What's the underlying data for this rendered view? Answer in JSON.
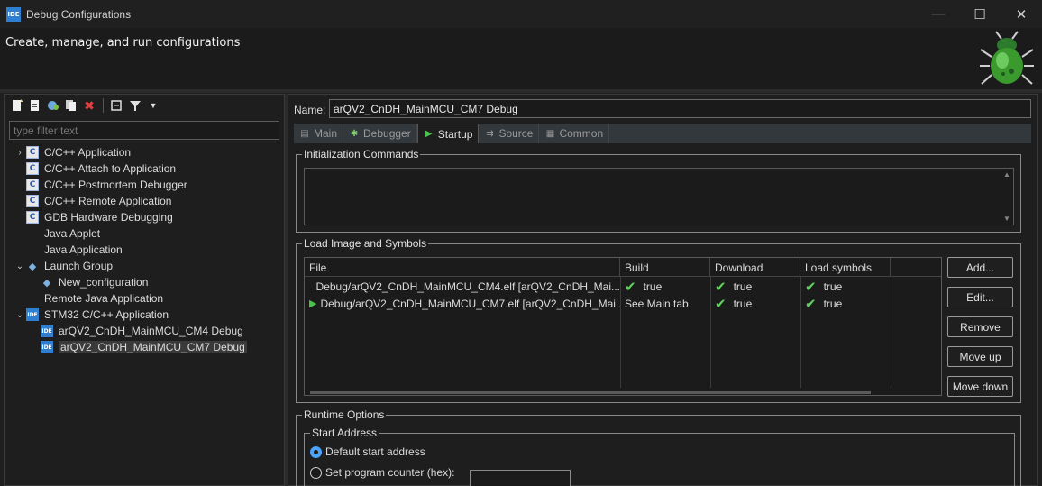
{
  "window": {
    "title": "Debug Configurations",
    "app_icon": "IDE"
  },
  "banner": {
    "text": "Create, manage, and run configurations"
  },
  "filter": {
    "placeholder": "type filter text"
  },
  "tree": [
    {
      "label": "C/C++ Application",
      "icon": "C",
      "indent": 0,
      "twisty": "›"
    },
    {
      "label": "C/C++ Attach to Application",
      "icon": "C",
      "indent": 0,
      "twisty": ""
    },
    {
      "label": "C/C++ Postmortem Debugger",
      "icon": "C",
      "indent": 0,
      "twisty": ""
    },
    {
      "label": "C/C++ Remote Application",
      "icon": "C",
      "indent": 0,
      "twisty": ""
    },
    {
      "label": "GDB Hardware Debugging",
      "icon": "C",
      "indent": 0,
      "twisty": ""
    },
    {
      "label": "Java Applet",
      "icon": "",
      "indent": 0,
      "twisty": ""
    },
    {
      "label": "Java Application",
      "icon": "",
      "indent": 0,
      "twisty": ""
    },
    {
      "label": "Launch Group",
      "icon": "grp",
      "indent": 0,
      "twisty": "⌄"
    },
    {
      "label": "New_configuration",
      "icon": "grp",
      "indent": 1,
      "twisty": ""
    },
    {
      "label": "Remote Java Application",
      "icon": "",
      "indent": 0,
      "twisty": ""
    },
    {
      "label": "STM32 C/C++ Application",
      "icon": "IDE",
      "indent": 0,
      "twisty": "⌄"
    },
    {
      "label": "arQV2_CnDH_MainMCU_CM4 Debug",
      "icon": "IDE",
      "indent": 1,
      "twisty": ""
    },
    {
      "label": "arQV2_CnDH_MainMCU_CM7 Debug",
      "icon": "IDE",
      "indent": 1,
      "twisty": "",
      "selected": true
    }
  ],
  "config": {
    "name_label": "Name:",
    "name_value": "arQV2_CnDH_MainMCU_CM7 Debug"
  },
  "tabs": [
    {
      "label": "Main",
      "icon": "▤"
    },
    {
      "label": "Debugger",
      "icon": "✱"
    },
    {
      "label": "Startup",
      "icon": "▶",
      "active": true
    },
    {
      "label": "Source",
      "icon": "⇉"
    },
    {
      "label": "Common",
      "icon": "▦"
    }
  ],
  "init": {
    "title": "Initialization Commands"
  },
  "load": {
    "title": "Load Image and Symbols",
    "columns": [
      "File",
      "Build",
      "Download",
      "Load symbols"
    ],
    "rows": [
      {
        "file": "Debug/arQV2_CnDH_MainMCU_CM4.elf [arQV2_CnDH_Mai...",
        "build": "true",
        "build_check": true,
        "download": "true",
        "symbols": "true",
        "play": false
      },
      {
        "file": "Debug/arQV2_CnDH_MainMCU_CM7.elf [arQV2_CnDH_Mai...",
        "build": "See Main tab",
        "build_check": false,
        "download": "true",
        "symbols": "true",
        "play": true
      }
    ],
    "buttons": {
      "add": "Add...",
      "edit": "Edit...",
      "remove": "Remove",
      "up": "Move up",
      "down": "Move down"
    }
  },
  "runtime": {
    "title": "Runtime Options",
    "start_title": "Start Address",
    "default_label": "Default start address",
    "pc_label": "Set program counter (hex):",
    "pc_value": ""
  },
  "colors": {
    "accent": "#4aa3ff",
    "check": "#5fd35f",
    "ide_icon": "#2f7fd1"
  }
}
